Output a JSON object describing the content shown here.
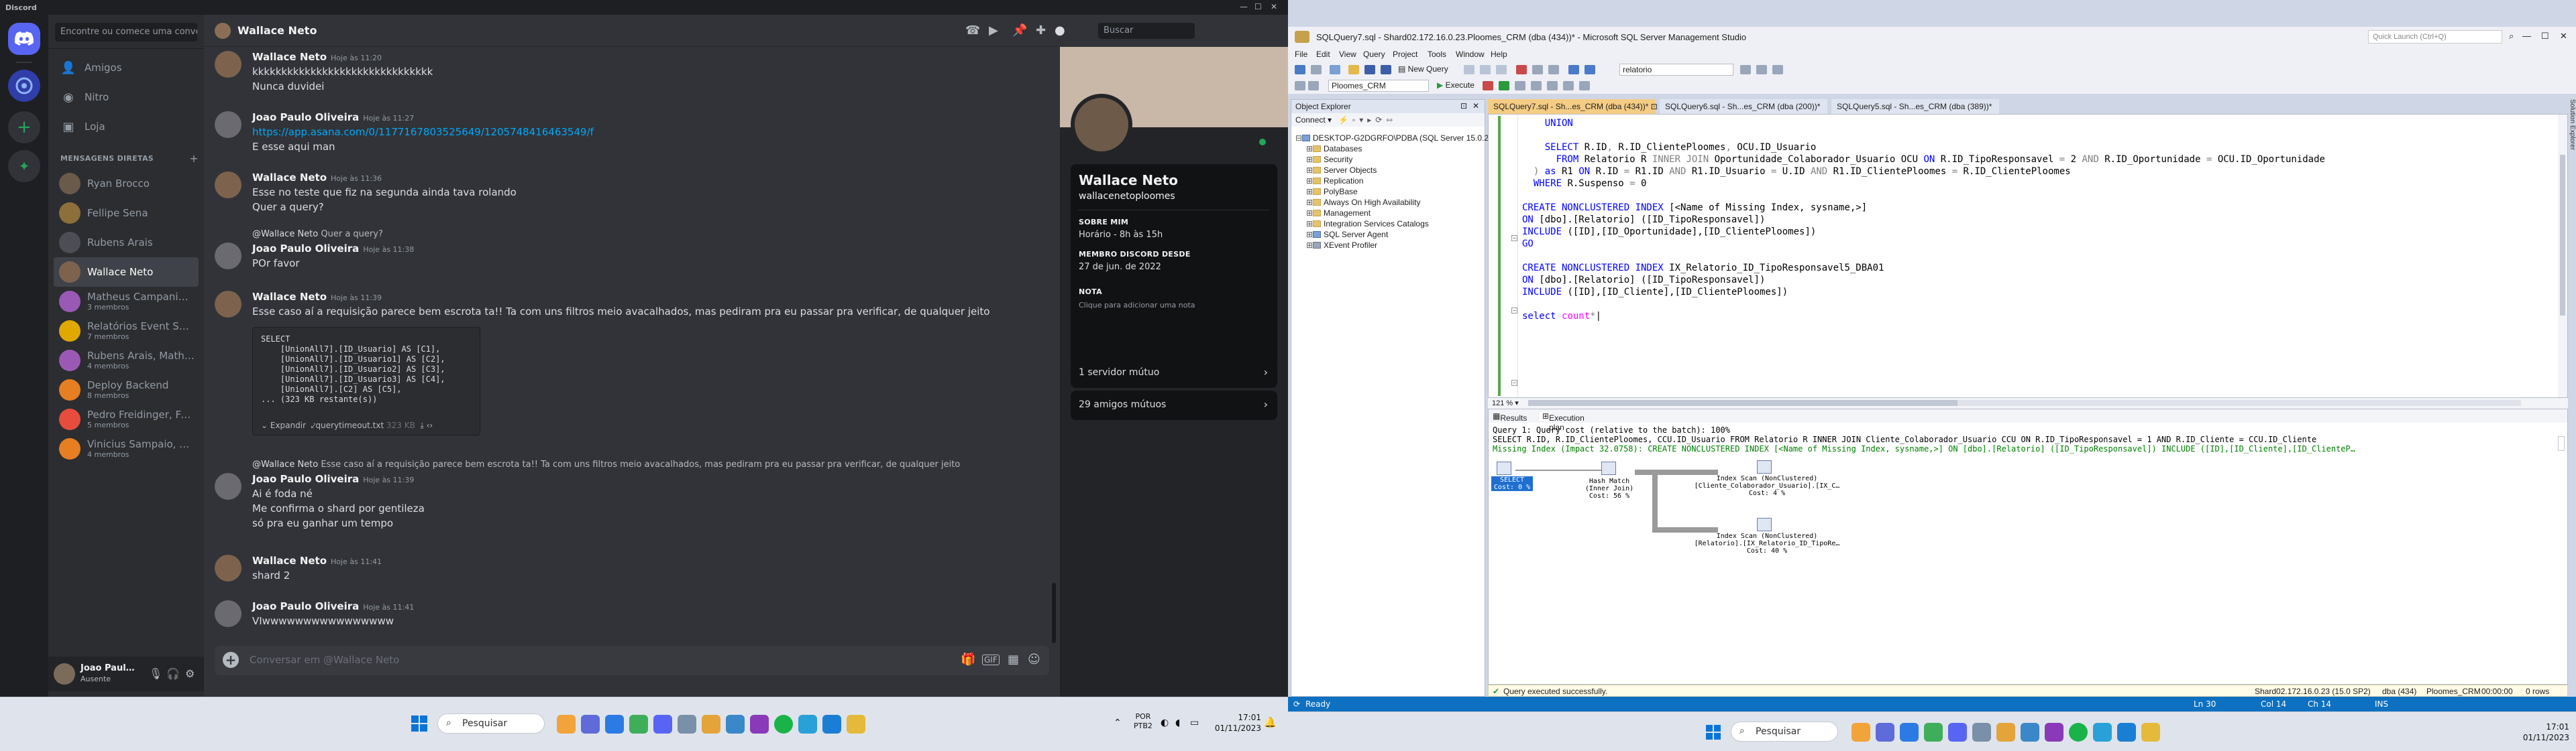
{
  "discord": {
    "titlebar": {
      "title": "Discord"
    },
    "search_placeholder": "Encontre ou comece uma conver…",
    "nav": [
      {
        "label": "Amigos",
        "icon": "friends-icon"
      },
      {
        "label": "Nitro",
        "icon": "nitro-icon"
      },
      {
        "label": "Loja",
        "icon": "shop-icon"
      }
    ],
    "dm_header": "MENSAGENS DIRETAS",
    "dms": [
      {
        "name": "Ryan Brocco",
        "sub": "",
        "color": "#6a5a4a"
      },
      {
        "name": "Fellipe Sena",
        "sub": "",
        "color": "#8c6f3a"
      },
      {
        "name": "Rubens Arais",
        "sub": "",
        "color": "#4d4d55"
      },
      {
        "name": "Wallace Neto",
        "sub": "",
        "color": "#7d634d"
      },
      {
        "name": "Matheus Campanini, …",
        "sub": "3 membros",
        "color": "#9b59b6"
      },
      {
        "name": "Relatórios Event Shoo…",
        "sub": "7 membros",
        "color": "#e0a800"
      },
      {
        "name": "Rubens Arais, Matheu…",
        "sub": "4 membros",
        "color": "#9b59b6"
      },
      {
        "name": "Deploy Backend",
        "sub": "8 membros",
        "color": "#e67e22"
      },
      {
        "name": "Pedro Freidinger, Fern…",
        "sub": "5 membros",
        "color": "#e74c3c"
      },
      {
        "name": "Vinicius Sampaio, Raf…",
        "sub": "4 membros",
        "color": "#e67e22"
      }
    ],
    "user": {
      "name": "Joao Paul…",
      "status": "Ausente"
    },
    "chat": {
      "header_name": "Wallace Neto",
      "search_placeholder": "Buscar",
      "composer_placeholder": "Conversar em @Wallace Neto",
      "messages": [
        {
          "author": "Wallace Neto",
          "time": "Hoje às 11:20",
          "lines": [
            "kkkkkkkkkkkkkkkkkkkkkkkkkkkkkkk",
            "Nunca duvidei"
          ]
        },
        {
          "author": "Joao Paulo Oliveira",
          "time": "Hoje às 11:27",
          "lines": [
            "https://app.asana.com/0/1177167803525649/1205748416463549/f",
            "E esse aqui man"
          ]
        },
        {
          "author": "Wallace Neto",
          "time": "Hoje às 11:36",
          "lines": [
            "Esse no teste que fiz na segunda ainda tava rolando",
            "Quer a query?"
          ]
        },
        {
          "reply_author": "@Wallace Neto",
          "reply_text": "Quer a query?",
          "author": "Joao Paulo Oliveira",
          "time": "Hoje às 11:38",
          "lines": [
            "POr favor"
          ]
        },
        {
          "author": "Wallace Neto",
          "time": "Hoje às 11:39",
          "lines": [
            "Esse caso aí a requisição parece bem escrota ta!! Ta com uns filtros meio avacalhados, mas pediram pra eu passar pra verificar, de qualquer jeito"
          ]
        },
        {
          "reply_author": "@Wallace Neto",
          "reply_text": "Esse caso aí a requisição parece bem escrota ta!! Ta com uns filtros meio avacalhados, mas pediram pra eu passar pra verificar, de qualquer jeito",
          "author": "Joao Paulo Oliveira",
          "time": "Hoje às 11:39",
          "lines": [
            "Ai é foda né",
            "Me confirma o shard por gentileza",
            "só pra eu ganhar um tempo"
          ]
        },
        {
          "author": "Wallace Neto",
          "time": "Hoje às 11:41",
          "lines": [
            "shard 2"
          ]
        },
        {
          "author": "Joao Paulo Oliveira",
          "time": "Hoje às 11:41",
          "lines": [
            "VIwwwwwwwwwwwwwwww"
          ]
        }
      ],
      "code": {
        "text": "SELECT\n    [UnionAll7].[ID_Usuario] AS [C1],\n    [UnionAll7].[ID_Usuario1] AS [C2],\n    [UnionAll7].[ID_Usuario2] AS [C3],\n    [UnionAll7].[ID_Usuario3] AS [C4],\n    [UnionAll7].[C2] AS [C5],\n... (323 KB restante(s))",
        "expand": "Expandir",
        "filename": "querytimeout.txt",
        "size": "323 KB"
      }
    },
    "profile": {
      "name": "Wallace Neto",
      "username": "wallacenetoploomes",
      "about_label": "SOBRE MIM",
      "about_value": "Horário - 8h às 15h",
      "member_label": "MEMBRO DISCORD DESDE",
      "member_value": "27 de jun. de 2022",
      "note_label": "NOTA",
      "note_placeholder": "Clique para adicionar uma nota",
      "mutual_servers": "1 servidor mútuo",
      "mutual_friends": "29 amigos mútuos"
    }
  },
  "taskbar_left": {
    "search": "Pesquisar",
    "lang": "POR",
    "layout": "PTB2",
    "time": "17:01",
    "date": "01/11/2023"
  },
  "taskbar_right": {
    "search": "Pesquisar",
    "time": "17:01",
    "date": "01/11/2023"
  },
  "ssms": {
    "title": "SQLQuery7.sql - Shard02.172.16.0.23.Ploomes_CRM (dba (434))* - Microsoft SQL Server Management Studio",
    "quick_launch": "Quick Launch (Ctrl+Q)",
    "menu": [
      "File",
      "Edit",
      "View",
      "Query",
      "Project",
      "Tools",
      "Window",
      "Help"
    ],
    "toolbar": {
      "new_query": "New Query",
      "db_search": "relatorio",
      "database": "Ploomes_CRM",
      "execute": "Execute"
    },
    "object_explorer": {
      "title": "Object Explorer",
      "connect": "Connect",
      "server": "DESKTOP-G2DGRFO\\PDBA (SQL Server 15.0.2000.5 - dba)",
      "nodes": [
        "Databases",
        "Security",
        "Server Objects",
        "Replication",
        "PolyBase",
        "Always On High Availability",
        "Management",
        "Integration Services Catalogs",
        "SQL Server Agent",
        "XEvent Profiler"
      ]
    },
    "tabs": [
      {
        "label": "SQLQuery7.sql - Sh...es_CRM (dba (434))*",
        "active": true
      },
      {
        "label": "SQLQuery6.sql - Sh...es_CRM (dba (200))*",
        "active": false
      },
      {
        "label": "SQLQuery5.sql - Sh...es_CRM (dba (389))*",
        "active": false
      }
    ],
    "zoom": "121 %",
    "results_tabs": {
      "results": "Results",
      "plan": "Execution plan"
    },
    "plan": {
      "line1": "Query 1: Query cost (relative to the batch): 100%",
      "line2": "SELECT R.ID, R.ID_ClientePloomes, CCU.ID_Usuario FROM Relatorio R INNER JOIN Cliente_Colaborador_Usuario CCU ON R.ID_TipoResponsavel = 1 AND R.ID_Cliente = CCU.ID_Cliente",
      "line3": "Missing Index (Impact 32.0758): CREATE NONCLUSTERED INDEX [<Name of Missing Index, sysname,>] ON [dbo].[Relatorio] ([ID_TipoResponsavel]) INCLUDE ([ID],[ID_Cliente],[ID_ClienteP…",
      "select_op": "SELECT\nCost: 0 %",
      "hash_op": "Hash Match\n(Inner Join)\nCost: 56 %",
      "scan1_op": "Index Scan (NonClustered)\n[Cliente_Colaborador_Usuario].[IX_C…\nCost: 4 %",
      "scan2_op": "Index Scan (NonClustered)\n[Relatorio].[IX_Relatorio_ID_TipoRe…\nCost: 40 %"
    },
    "query_status": {
      "message": "Query executed successfully.",
      "server": "Shard02.172.16.0.23 (15.0 SP2)",
      "user": "dba (434)",
      "db": "Ploomes_CRM",
      "time": "00:00:00",
      "rows": "0 rows"
    },
    "status": {
      "ready": "Ready",
      "ln": "Ln 30",
      "col": "Col 14",
      "ch": "Ch 14",
      "ins": "INS"
    },
    "right_panel": "Solution Explorer",
    "colors": {
      "status_blue": "#0e70c0",
      "keyword": "#0000ff",
      "comment": "#008000"
    }
  }
}
